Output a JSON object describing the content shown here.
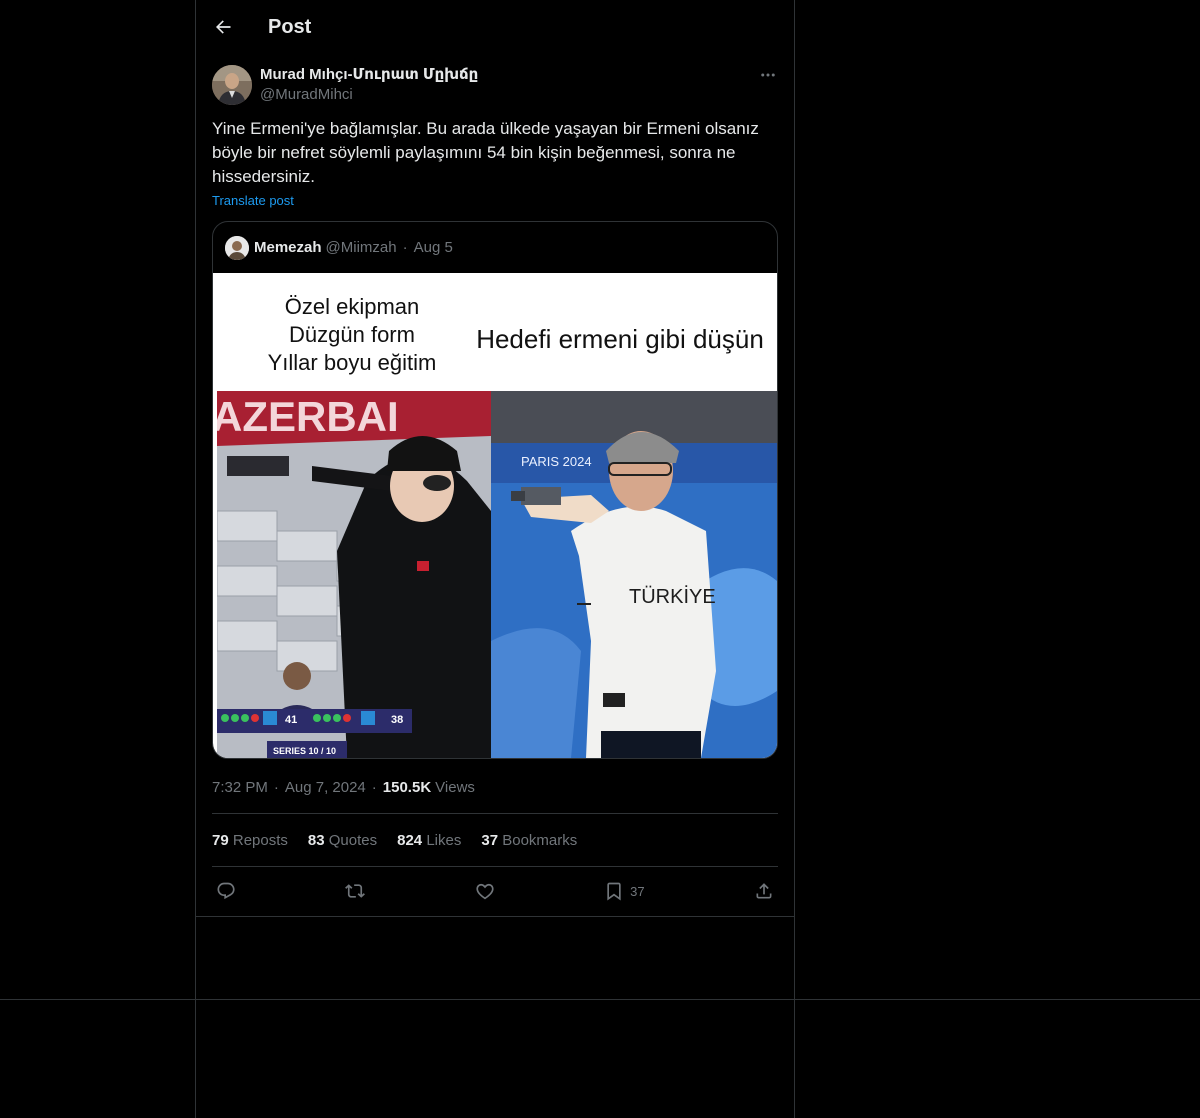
{
  "header": {
    "title": "Post"
  },
  "post": {
    "author_name": "Murad Mıhçı-Մուրատ Մըխճը",
    "author_handle": "@MuradMihci",
    "text": "Yine Ermeni'ye bağlamışlar. Bu arada ülkede yaşayan bir Ermeni olsanız böyle bir nefret söylemli paylaşımını 54 bin kişin beğenmesi, sonra ne hissedersiniz.",
    "translate_label": "Translate post",
    "time": "7:32 PM",
    "date": "Aug 7, 2024",
    "views_count": "150.5K",
    "views_label": "Views"
  },
  "quote": {
    "name": "Memezah",
    "handle": "@Miimzah",
    "date": "Aug 5",
    "meme_left_lines": [
      "Özel ekipman",
      "Düzgün form",
      "Yıllar boyu eğitim"
    ],
    "meme_right_text": "Hedefi ermeni gibi düşün",
    "score_left": "41",
    "score_right": "38",
    "series_text": "SERIES 10 / 10",
    "banner_text": "AZERBAI",
    "paris_text": "PARIS 2024",
    "shirt_text": "TÜRKİYE"
  },
  "stats": {
    "reposts_count": "79",
    "reposts_label": "Reposts",
    "quotes_count": "83",
    "quotes_label": "Quotes",
    "likes_count": "824",
    "likes_label": "Likes",
    "bookmarks_count": "37",
    "bookmarks_label": "Bookmarks"
  },
  "actions": {
    "bookmark_count": "37"
  },
  "icons": [
    "back-arrow-icon",
    "more-icon",
    "reply-icon",
    "repost-icon",
    "like-icon",
    "bookmark-icon",
    "share-icon"
  ]
}
